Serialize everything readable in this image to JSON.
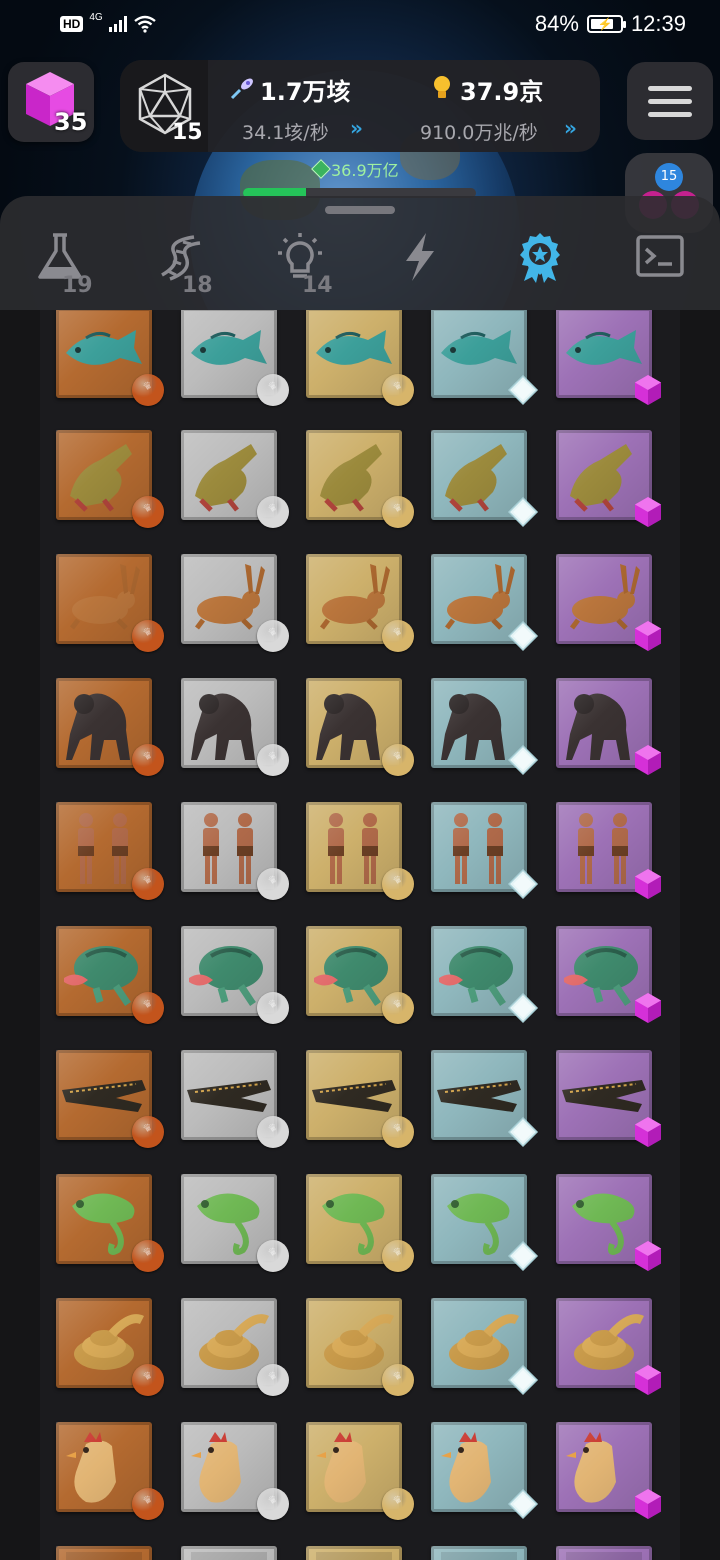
{
  "status_bar": {
    "network_badge": "HD",
    "network_type": "4G",
    "battery": "84%",
    "time": "12:39"
  },
  "header": {
    "cube_count": "35",
    "d20_count": "15",
    "resource_primary_value": "1.7万垓",
    "resource_primary_rate": "34.1垓/秒",
    "resource_secondary_value": "37.9京",
    "resource_secondary_rate": "910.0万兆/秒",
    "gem_total": "36.9万亿",
    "progress_fraction": 0.27,
    "avatar_badge": "15"
  },
  "tabs": [
    {
      "icon": "flask-icon",
      "count": "19",
      "active": false
    },
    {
      "icon": "dna-icon",
      "count": "18",
      "active": false
    },
    {
      "icon": "lightbulb-icon",
      "count": "14",
      "active": false
    },
    {
      "icon": "lightning-icon",
      "count": "",
      "active": false
    },
    {
      "icon": "achievement-medal-icon",
      "count": "",
      "active": true
    },
    {
      "icon": "terminal-icon",
      "count": "",
      "active": false
    }
  ],
  "tiers": [
    {
      "name": "bronze",
      "bg": "#b46a30",
      "badge": "#c3541c",
      "badge_shape": "circle"
    },
    {
      "name": "silver",
      "bg": "#bcbcbc",
      "badge": "#d9d9d9",
      "badge_shape": "circle"
    },
    {
      "name": "gold",
      "bg": "#cdb06b",
      "badge": "#d7b56a",
      "badge_shape": "circle"
    },
    {
      "name": "diamond",
      "bg": "#8fb7bd",
      "badge": "#e4f4f6",
      "badge_shape": "diamond"
    },
    {
      "name": "amethyst",
      "bg": "#9d71b6",
      "badge": "#d530d8",
      "badge_shape": "hexagon"
    }
  ],
  "animals": [
    "fish",
    "tetrapod",
    "rabbit",
    "gorilla",
    "humans",
    "turtle",
    "crocodile",
    "chameleon",
    "snake",
    "chicken",
    "next"
  ],
  "colors": {
    "accent_blue": "#34a5e0",
    "progress_green": "#25c459",
    "medal_blue": "#42b6e8"
  }
}
